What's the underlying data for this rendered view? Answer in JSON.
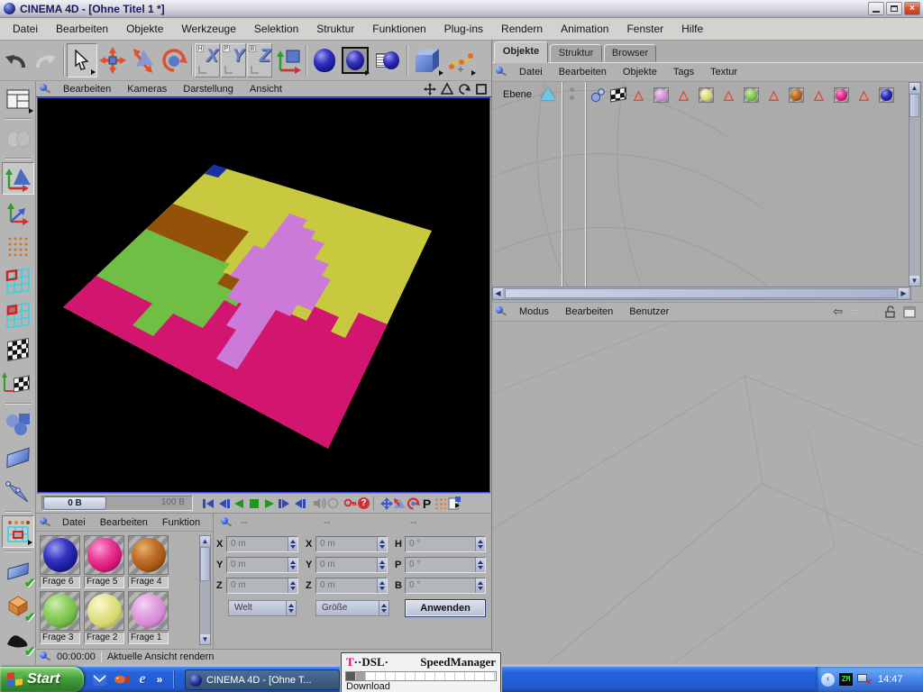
{
  "window": {
    "title": "CINEMA 4D - [Ohne Titel 1 *]"
  },
  "menu_bar": [
    "Datei",
    "Bearbeiten",
    "Objekte",
    "Werkzeuge",
    "Selektion",
    "Struktur",
    "Funktionen",
    "Plug-ins",
    "Rendern",
    "Animation",
    "Fenster",
    "Hilfe"
  ],
  "toolbar": {
    "icons": [
      "undo",
      "redo",
      "live-selection",
      "move",
      "scale",
      "rotate",
      "lock-x",
      "lock-y",
      "lock-z",
      "coordinate-system",
      "render-view",
      "render-in-picture-viewer",
      "render-settings",
      "add-cube-primitive",
      "add-spline"
    ],
    "axis_buttons": [
      {
        "sub": "H",
        "main": "X"
      },
      {
        "sub": "P",
        "main": "Y"
      },
      {
        "sub": "B",
        "main": "Z"
      }
    ]
  },
  "left_toolbar_icons": [
    "layout",
    "make-editable",
    "model-mode",
    "object-axis-mode",
    "points-mode",
    "edges-mode",
    "polygons-mode",
    "texture-mode",
    "texture-axis-mode",
    "object-mode",
    "workplane-mode",
    "bones-mode",
    "selection-filter",
    "toggle-workplane",
    "toggle-box",
    "toggle-shading",
    "toggle-particles"
  ],
  "viewport": {
    "menu": [
      "Bearbeiten",
      "Kameras",
      "Darstellung",
      "Ansicht"
    ],
    "nav_icons": [
      "pan-view",
      "scale-view",
      "rotate-view",
      "toggle-views"
    ],
    "region_colors": {
      "background": "#000000",
      "yellow": "#c9c93f",
      "brown": "#935207",
      "green": "#70bf45",
      "magenta": "#d2156f",
      "orchid": "#cb7ad8",
      "blue": "#1b2fa8"
    }
  },
  "timeline": {
    "current": "0 B",
    "end": "100 B",
    "p_icon": "P"
  },
  "right_tabs": [
    "Objekte",
    "Struktur",
    "Browser"
  ],
  "object_manager": {
    "menu": [
      "Datei",
      "Bearbeiten",
      "Objekte",
      "Tags",
      "Textur"
    ],
    "object_name": "Ebene",
    "tag_icons": [
      "phong-tag",
      "uvw-tag"
    ],
    "texture_tag_colors": [
      "#d88ad8",
      "#d8d870",
      "#74be4a",
      "#a85a12",
      "#d81878",
      "#1d1d9e"
    ]
  },
  "attribute_manager": {
    "menu": [
      "Modus",
      "Bearbeiten",
      "Benutzer"
    ],
    "nav_icons": [
      "back",
      "forward",
      "up",
      "lock",
      "layout"
    ]
  },
  "material_manager": {
    "menu": [
      "Datei",
      "Bearbeiten",
      "Funktion"
    ],
    "materials": [
      {
        "name": "Frage 6",
        "color": "#1d1d9e"
      },
      {
        "name": "Frage 5",
        "color": "#d81878"
      },
      {
        "name": "Frage 4",
        "color": "#a85a12"
      },
      {
        "name": "Frage 3",
        "color": "#74be4a"
      },
      {
        "name": "Frage 2",
        "color": "#d8d870"
      },
      {
        "name": "Frage 1",
        "color": "#d88ad8"
      }
    ]
  },
  "coordinates": {
    "headers": [
      "--",
      "--",
      "--"
    ],
    "col1": [
      {
        "l": "X",
        "v": "0 m"
      },
      {
        "l": "Y",
        "v": "0 m"
      },
      {
        "l": "Z",
        "v": "0 m"
      }
    ],
    "col2": [
      {
        "l": "X",
        "v": "0 m"
      },
      {
        "l": "Y",
        "v": "0 m"
      },
      {
        "l": "Z",
        "v": "0 m"
      }
    ],
    "col3": [
      {
        "l": "H",
        "v": "0 °"
      },
      {
        "l": "P",
        "v": "0 °"
      },
      {
        "l": "B",
        "v": "0 °"
      }
    ],
    "system_select": "Welt",
    "size_select": "Größe",
    "apply": "Anwenden"
  },
  "status_bar": {
    "time": "00:00:00",
    "message": "Aktuelle Ansicht rendern"
  },
  "taskbar": {
    "start": "Start",
    "quick_launch_icons": [
      "outlook",
      "media",
      "internet-explorer"
    ],
    "ie_glyph": "e",
    "overflow": "»",
    "task_button": "CINEMA 4D - [Ohne T...",
    "tray_icon_text": "ZM",
    "clock": "14:47"
  },
  "dsl_widget": {
    "brand_t": "T",
    "brand_rest": "··DSL·",
    "name": "SpeedManager",
    "label": "Download"
  }
}
